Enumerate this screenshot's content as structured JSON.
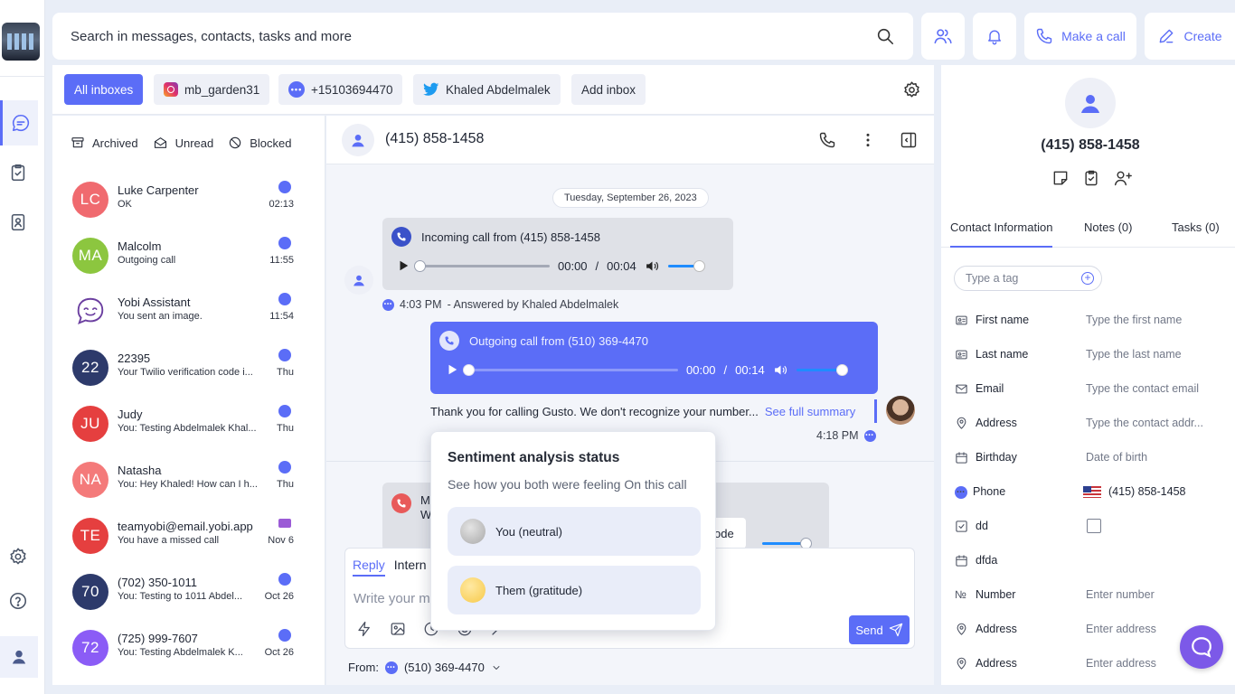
{
  "search": {
    "placeholder": "Search in messages, contacts, tasks and more"
  },
  "topbar": {
    "make_call": "Make a call",
    "create": "Create"
  },
  "inboxes": [
    {
      "label": "All inboxes"
    },
    {
      "label": "mb_garden31",
      "icon": "instagram-icon"
    },
    {
      "label": "+15103694470",
      "icon": "chat-icon"
    },
    {
      "label": "Khaled Abdelmalek",
      "icon": "twitter-icon"
    },
    {
      "label": "Add inbox"
    }
  ],
  "filters": {
    "archived": "Archived",
    "unread": "Unread",
    "blocked": "Blocked"
  },
  "conversations": [
    {
      "initials": "LC",
      "name": "Luke Carpenter",
      "preview": "OK",
      "time": "02:13",
      "color": "#f06a6f"
    },
    {
      "initials": "MA",
      "name": "Malcolm",
      "preview": "Outgoing call",
      "time": "11:55",
      "color": "#8cc63f"
    },
    {
      "initials": "",
      "name": "Yobi Assistant",
      "preview": "You sent an image.",
      "time": "11:54",
      "color": "#ffffff"
    },
    {
      "initials": "22",
      "name": "22395",
      "preview": "Your Twilio verification code i...",
      "time": "Thu",
      "color": "#2d3a6b"
    },
    {
      "initials": "JU",
      "name": "Judy",
      "preview": "You: Testing Abdelmalek Khal...",
      "time": "Thu",
      "color": "#e53f3f"
    },
    {
      "initials": "NA",
      "name": "Natasha",
      "preview": "You: Hey Khaled! How can I h...",
      "time": "Thu",
      "color": "#f47a7a"
    },
    {
      "initials": "TE",
      "name": "teamyobi@email.yobi.app",
      "preview": "You have a missed call",
      "time": "Nov 6",
      "color": "#e53f3f"
    },
    {
      "initials": "70",
      "name": "(702) 350-1011",
      "preview": "You: Testing to 1011 Abdel...",
      "time": "Oct 26",
      "color": "#2d3a6b"
    },
    {
      "initials": "72",
      "name": "(725) 999-7607",
      "preview": "You: Testing Abdelmalek K...",
      "time": "Oct 26",
      "color": "#8b5cf6"
    }
  ],
  "chat": {
    "title": "(415) 858-1458",
    "date": "Tuesday, September 26, 2023",
    "incoming": {
      "label": "Incoming call from (415) 858-1458",
      "pos": "00:00",
      "sep": "/",
      "dur": "00:04"
    },
    "incoming_meta": {
      "time": "4:03 PM",
      "answered": "- Answered by Khaled Abdelmalek"
    },
    "outgoing": {
      "label": "Outgoing call from (510) 369-4470",
      "pos": "00:00",
      "sep": "/",
      "dur": "00:14"
    },
    "transcript": "Thank you for calling Gusto. We don't recognize your number...",
    "see_summary": "See full summary",
    "outgoing_time": "4:18 PM",
    "missed_line1": "M",
    "missed_line2": "W",
    "mode_chip": "ode"
  },
  "composer": {
    "reply_tab": "Reply",
    "internal_tab": "Intern",
    "placeholder": "Write your m",
    "send": "Send",
    "from_label": "From:",
    "from_number": "(510) 369-4470"
  },
  "sentiment": {
    "title": "Sentiment analysis status",
    "subtitle": "See how you both were feeling On this call",
    "you": "You (neutral)",
    "them": "Them (gratitude)"
  },
  "contact": {
    "name": "(415) 858-1458",
    "tabs": {
      "info": "Contact Information",
      "notes": "Notes (0)",
      "tasks": "Tasks (0)"
    },
    "tag_placeholder": "Type a tag",
    "fields": [
      {
        "label": "First name",
        "value": "Type the first name"
      },
      {
        "label": "Last name",
        "value": "Type the last name"
      },
      {
        "label": "Email",
        "value": "Type the contact email"
      },
      {
        "label": "Address",
        "value": "Type the contact addr..."
      },
      {
        "label": "Birthday",
        "value": "Date of birth"
      },
      {
        "label": "Phone",
        "value": "(415) 858-1458"
      },
      {
        "label": "dd",
        "value": ""
      },
      {
        "label": "dfda",
        "value": ""
      },
      {
        "label": "Number",
        "value": "Enter number"
      },
      {
        "label": "Address",
        "value": "Enter address"
      },
      {
        "label": "Address",
        "value": "Enter address"
      }
    ]
  },
  "colors": {
    "accent": "#5b6df7",
    "help": "#7c59e8"
  }
}
